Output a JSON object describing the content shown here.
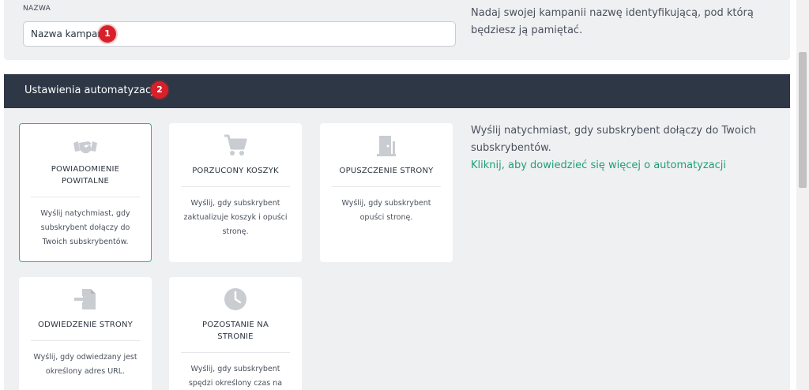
{
  "name_section": {
    "label": "NAZWA",
    "input_value": "Nazwa kampanii",
    "badge": "1",
    "help_text": "Nadaj swojej kampanii nazwę identyfikującą, pod którą będziesz ją pamiętać."
  },
  "automation": {
    "title": "Ustawienia automatyzacji",
    "badge": "2",
    "help_text": "Wyślij natychmiast, gdy subskrybent dołączy do Twoich subskrybentów.",
    "link_text": "Kliknij, aby dowiedzieć się więcej o automatyzacji",
    "cards": [
      {
        "title": "POWIADOMIENIE POWITALNE",
        "description": "Wyślij natychmiast, gdy subskrybent dołączy do Twoich subskrybentów.",
        "icon": "handshake-icon",
        "selected": true
      },
      {
        "title": "PORZUCONY KOSZYK",
        "description": "Wyślij, gdy subskrybent zaktualizuje koszyk i opuści stronę.",
        "icon": "cart-icon",
        "selected": false
      },
      {
        "title": "OPUSZCZENIE STRONY",
        "description": "Wyślij, gdy subskrybent opuści stronę.",
        "icon": "door-exit-icon",
        "selected": false
      },
      {
        "title": "ODWIEDZENIE STRONY",
        "description": "Wyślij, gdy odwiedzany jest określony adres URL.",
        "icon": "enter-page-icon",
        "selected": false
      },
      {
        "title": "POZOSTANIE NA STRONIE",
        "description": "Wyślij, gdy subskrybent spędzi określony czas na określonym adresie URL.",
        "icon": "clock-icon",
        "selected": false
      }
    ]
  },
  "colors": {
    "header_bg": "#2d3746",
    "accent_green": "#30b291",
    "link_green": "#1f9f73",
    "badge_red": "#d8202a",
    "panel_bg": "#eff0f2"
  }
}
